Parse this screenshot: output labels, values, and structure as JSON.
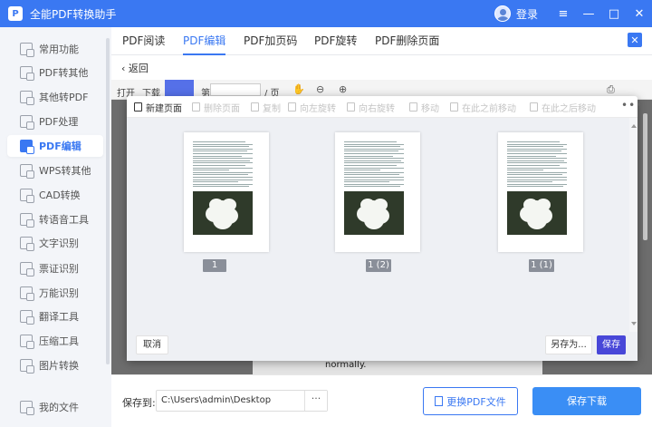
{
  "app": {
    "title": "全能PDF转换助手",
    "logo_letter": "P",
    "login_label": "登录"
  },
  "window_controls": {
    "menu": "≡",
    "minimize": "—",
    "maximize": "□",
    "close": "✕"
  },
  "sidebar": {
    "items": [
      {
        "label": "常用功能",
        "icon": "star-icon"
      },
      {
        "label": "PDF转其他",
        "icon": "pdf-convert-icon"
      },
      {
        "label": "其他转PDF",
        "icon": "to-pdf-icon"
      },
      {
        "label": "PDF处理",
        "icon": "pdf-process-icon"
      },
      {
        "label": "PDF编辑",
        "icon": "pdf-edit-icon",
        "active": true
      },
      {
        "label": "WPS转其他",
        "icon": "wps-icon"
      },
      {
        "label": "CAD转换",
        "icon": "cad-icon"
      },
      {
        "label": "转语音工具",
        "icon": "speech-icon"
      },
      {
        "label": "文字识别",
        "icon": "ocr-icon"
      },
      {
        "label": "票证识别",
        "icon": "ticket-icon"
      },
      {
        "label": "万能识别",
        "icon": "universal-icon"
      },
      {
        "label": "翻译工具",
        "icon": "translate-icon"
      },
      {
        "label": "压缩工具",
        "icon": "compress-icon"
      },
      {
        "label": "图片转换",
        "icon": "image-icon"
      },
      {
        "label": "我的文件",
        "icon": "folder-icon"
      }
    ]
  },
  "tabs": [
    {
      "label": "PDF阅读"
    },
    {
      "label": "PDF编辑",
      "active": true
    },
    {
      "label": "PDF加页码"
    },
    {
      "label": "PDF旋转"
    },
    {
      "label": "PDF删除页面"
    }
  ],
  "back_label": "返回",
  "viewer_toolbar": {
    "open": "打开",
    "download": "下载",
    "page_prefix": "第",
    "page_suffix": "/ 页"
  },
  "background_text": "normally.",
  "dialog": {
    "toolbar": [
      {
        "label": "新建页面",
        "enabled": true
      },
      {
        "label": "删除页面",
        "enabled": false
      },
      {
        "label": "复制",
        "enabled": false
      },
      {
        "label": "向左旋转",
        "enabled": false
      },
      {
        "label": "向右旋转",
        "enabled": false
      },
      {
        "label": "移动",
        "enabled": false
      },
      {
        "label": "在此之前移动",
        "enabled": false
      },
      {
        "label": "在此之后移动",
        "enabled": false
      }
    ],
    "more": "•••",
    "pages": [
      {
        "label": "1"
      },
      {
        "label": "1 (2)"
      },
      {
        "label": "1 (1)"
      }
    ],
    "cancel_label": "取消",
    "save_as_label": "另存为...",
    "save_label": "保存"
  },
  "bottom": {
    "save_to_label": "保存到:",
    "path": "C:\\Users\\admin\\Desktop",
    "path_more": "···",
    "replace_label": "更换PDF文件",
    "save_download_label": "保存下载"
  },
  "colors": {
    "brand": "#3a78f2",
    "save_button": "#4847d8",
    "download_button": "#3a8ef5"
  }
}
